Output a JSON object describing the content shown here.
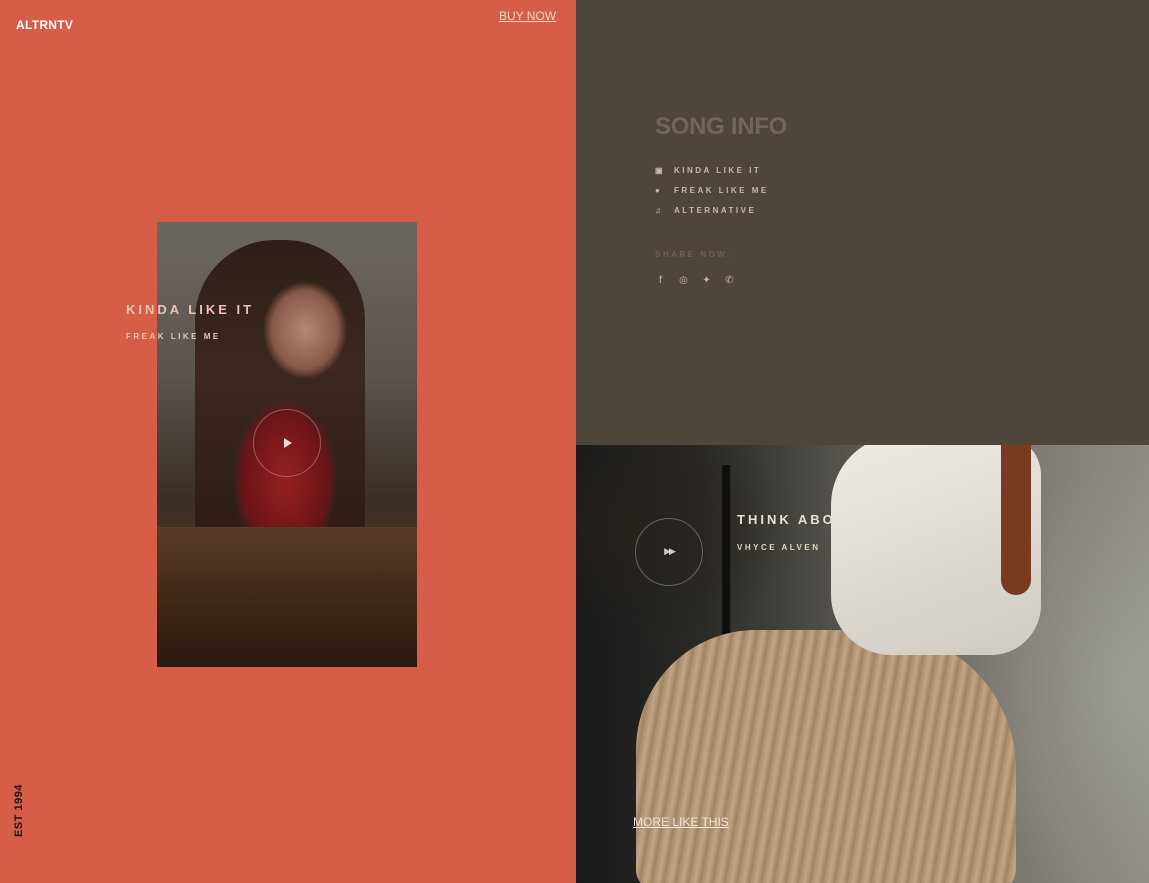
{
  "header": {
    "logo": "ALTRNTV",
    "buy_now": "BUY NOW"
  },
  "side": {
    "est": "EST 1994"
  },
  "featured": {
    "title": "KINDA LIKE IT",
    "artist": "FREAK LIKE ME",
    "play_icon": "play-icon"
  },
  "song_info": {
    "heading": "SONG INFO",
    "rows": [
      {
        "icon": "album-icon",
        "glyph": "▣",
        "label": "KINDA LIKE IT"
      },
      {
        "icon": "user-icon",
        "glyph": "●",
        "label": "FREAK LIKE ME"
      },
      {
        "icon": "music-note-icon",
        "glyph": "♫",
        "label": "ALTERNATIVE"
      }
    ],
    "share_label": "SHARE NOW :",
    "social": [
      {
        "icon": "facebook-icon",
        "glyph": "f"
      },
      {
        "icon": "instagram-icon",
        "glyph": "◎"
      },
      {
        "icon": "twitter-icon",
        "glyph": "✦"
      },
      {
        "icon": "whatsapp-icon",
        "glyph": "✆"
      }
    ]
  },
  "next_track": {
    "title": "THINK ABOUT IT",
    "artist": "VHYCE ALVEN",
    "ff_glyph": "▶▶",
    "more": "MORE LIKE THIS"
  },
  "colors": {
    "left_bg": "#d65d47",
    "right_bg": "#4f463b",
    "accent_text": "#ecc3b2"
  }
}
